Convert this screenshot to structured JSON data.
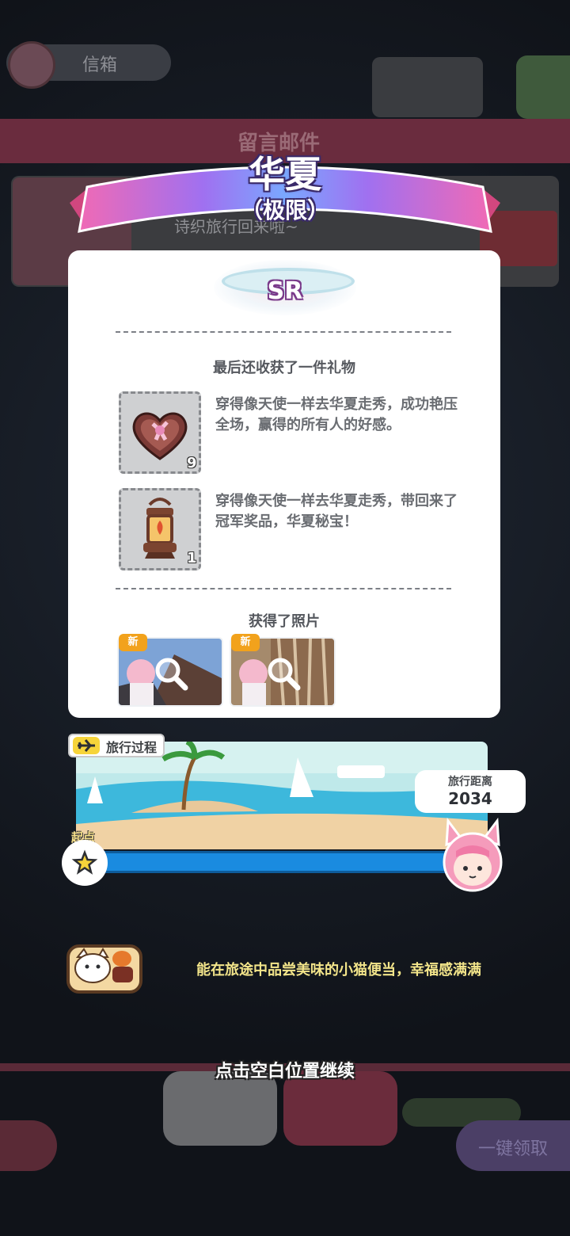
{
  "background": {
    "mailbox_label": "信箱",
    "mail_header": "留言邮件",
    "mail_preview": "诗织旅行回来啦~",
    "collect_all_label": "一键领取"
  },
  "title": {
    "location": "华夏",
    "difficulty": "（极限）"
  },
  "rarity": "SR",
  "gifts": {
    "section_title": "最后还收获了一件礼物",
    "items": [
      {
        "icon": "heart-chocolate-box-icon",
        "count": "9",
        "desc": "穿得像天使一样去华夏走秀，成功艳压全场，赢得的所有人的好感。"
      },
      {
        "icon": "lantern-icon",
        "count": "1",
        "desc": "穿得像天使一样去华夏走秀，带回来了冠军奖品，华夏秘宝！"
      }
    ]
  },
  "photos": {
    "section_title": "获得了照片",
    "items": [
      {
        "tag": "新"
      },
      {
        "tag": "新"
      }
    ]
  },
  "travel": {
    "tag_label": "旅行过程",
    "start_label": "起点",
    "distance_label": "旅行距离",
    "distance_value": "2034",
    "progress": 1.0
  },
  "event": {
    "icon": "cat-bento-icon",
    "text": "能在旅途中品尝美味的小猫便当，幸福感满满"
  },
  "continue_hint": "点击空白位置继续",
  "colors": {
    "card": "#ffffff",
    "progress": "#1a8be0",
    "new_tag": "#f2a21c",
    "event_text": "#f3e58a"
  }
}
